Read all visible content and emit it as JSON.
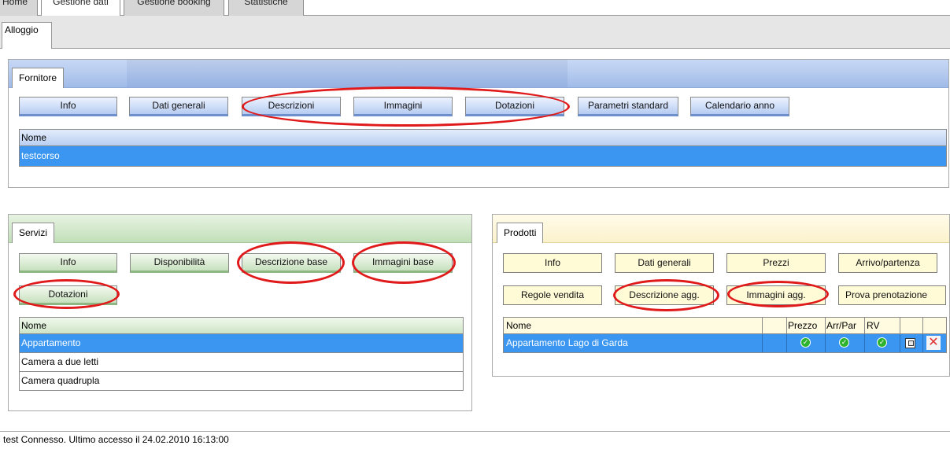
{
  "top_tabs": [
    {
      "label": "Home"
    },
    {
      "label": "Gestione dati"
    },
    {
      "label": "Gestione booking"
    },
    {
      "label": "Statistiche"
    }
  ],
  "sub_tab": {
    "label": "Alloggio"
  },
  "fornitore": {
    "tab_label": "Fornitore",
    "buttons": [
      "Info",
      "Dati generali",
      "Descrizioni",
      "Immagini",
      "Dotazioni",
      "Parametri standard",
      "Calendario anno"
    ],
    "grid": {
      "header": "Nome",
      "rows": [
        "testcorso"
      ]
    }
  },
  "servizi": {
    "tab_label": "Servizi",
    "buttons": [
      "Info",
      "Disponibilità",
      "Descrizione base",
      "Immagini base",
      "Dotazioni"
    ],
    "grid": {
      "header": "Nome",
      "rows": [
        "Appartamento",
        "Camera a due letti",
        "Camera quadrupla"
      ]
    }
  },
  "prodotti": {
    "tab_label": "Prodotti",
    "buttons": [
      "Info",
      "Dati generali",
      "Prezzi",
      "Arrivo/partenza",
      "Regole vendita",
      "Descrizione agg.",
      "Immagini agg.",
      "Prova prenotazione"
    ],
    "grid": {
      "headers": [
        "Nome",
        "",
        "Prezzo",
        "Arr/Par",
        "RV",
        "",
        ""
      ],
      "rows": [
        {
          "name": "Appartamento Lago di Garda"
        }
      ]
    }
  },
  "status_bar": "test Connesso. Ultimo accesso il 24.02.2010 16:13:00",
  "colors": {
    "annotation": "#e01a1a",
    "selection": "#3a96f0",
    "check": "#2db32d",
    "delete": "#e03030"
  },
  "icons": {
    "status_ok": "check-circle-icon",
    "copy": "copy-icon",
    "delete": "delete-x-icon"
  }
}
